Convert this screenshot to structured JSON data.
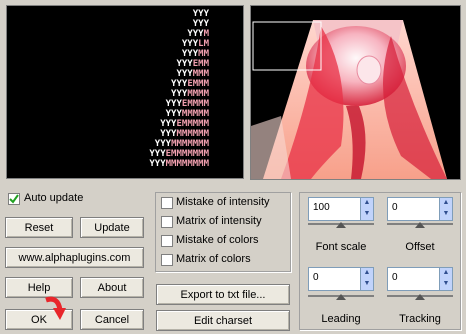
{
  "ascii_preview": {
    "rows": [
      [
        [
          "YYY",
          ""
        ]
      ],
      [
        [
          "YYY",
          ""
        ]
      ],
      [
        [
          "YYY",
          "M"
        ]
      ],
      [
        [
          "YYY",
          "LM"
        ]
      ],
      [
        [
          "YYY",
          "MM"
        ]
      ],
      [
        [
          "YYY",
          "EMM"
        ]
      ],
      [
        [
          "YYY",
          "MMM"
        ]
      ],
      [
        [
          "YYY",
          "EMMM"
        ]
      ],
      [
        [
          "YYY",
          "MMMM"
        ]
      ],
      [
        [
          "YYY",
          "EMMMM"
        ]
      ],
      [
        [
          "YYY",
          "MMMMM"
        ]
      ],
      [
        [
          "YYY",
          "EMMMMM"
        ]
      ],
      [
        [
          "YYY",
          "MMMMMM"
        ]
      ],
      [
        [
          "YYY",
          "MMMMMMM"
        ]
      ],
      [
        [
          "YYY",
          "EMMMMMMM"
        ]
      ],
      [
        [
          "YYY",
          "MMMMMMMM"
        ]
      ]
    ]
  },
  "auto_update": {
    "label": "Auto update",
    "checked": true
  },
  "buttons": {
    "reset": "Reset",
    "update": "Update",
    "website": "www.alphaplugins.com",
    "help": "Help",
    "about": "About",
    "ok": "OK",
    "cancel": "Cancel",
    "export": "Export to txt file...",
    "edit_charset": "Edit charset"
  },
  "options": [
    {
      "label": "Mistake of intensity",
      "checked": false
    },
    {
      "label": "Matrix of intensity",
      "checked": false
    },
    {
      "label": "Mistake of colors",
      "checked": false
    },
    {
      "label": "Matrix of colors",
      "checked": false
    }
  ],
  "controls": {
    "font_scale": {
      "label": "Font scale",
      "value": "100"
    },
    "offset": {
      "label": "Offset",
      "value": "0"
    },
    "leading": {
      "label": "Leading",
      "value": "0"
    },
    "tracking": {
      "label": "Tracking",
      "value": "0"
    }
  },
  "colors": {
    "ascii_white": "#ffffff",
    "ascii_pink": "#f2a0b0",
    "accent_red": "#e8262b"
  }
}
